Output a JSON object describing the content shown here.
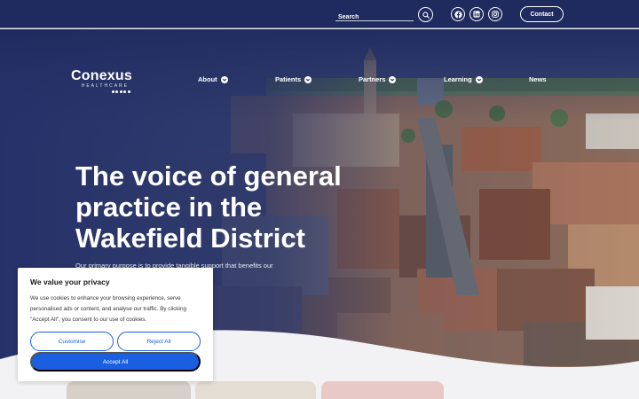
{
  "topbar": {
    "search_placeholder": "Search",
    "contact_label": "Contact",
    "icons": [
      "search-icon",
      "facebook-icon",
      "linkedin-icon",
      "instagram-icon"
    ]
  },
  "logo": {
    "name": "Conexus",
    "tagline": "HEALTHCARE"
  },
  "nav": {
    "items": [
      {
        "label": "About",
        "has_dropdown": true
      },
      {
        "label": "Patients",
        "has_dropdown": true
      },
      {
        "label": "Partners",
        "has_dropdown": true
      },
      {
        "label": "Learning",
        "has_dropdown": true
      },
      {
        "label": "News",
        "has_dropdown": false
      }
    ]
  },
  "hero": {
    "title": "The voice of general practice in the Wakefield District",
    "text": "Our primary purpose is to provide tangible support that benefits our practices and the people of Wakefield."
  },
  "cookie": {
    "title": "We value your privacy",
    "text": "We use cookies to enhance your browsing experience, serve personalised ads or content, and analyse our traffic. By clicking \"Accept All\", you consent to our use of cookies.",
    "customise_label": "Customise",
    "reject_label": "Reject All",
    "accept_label": "Accept All"
  },
  "colors": {
    "navy": "#1f2b5e",
    "accent_blue": "#1a5fe0",
    "page_bg": "#f2f2f4"
  }
}
